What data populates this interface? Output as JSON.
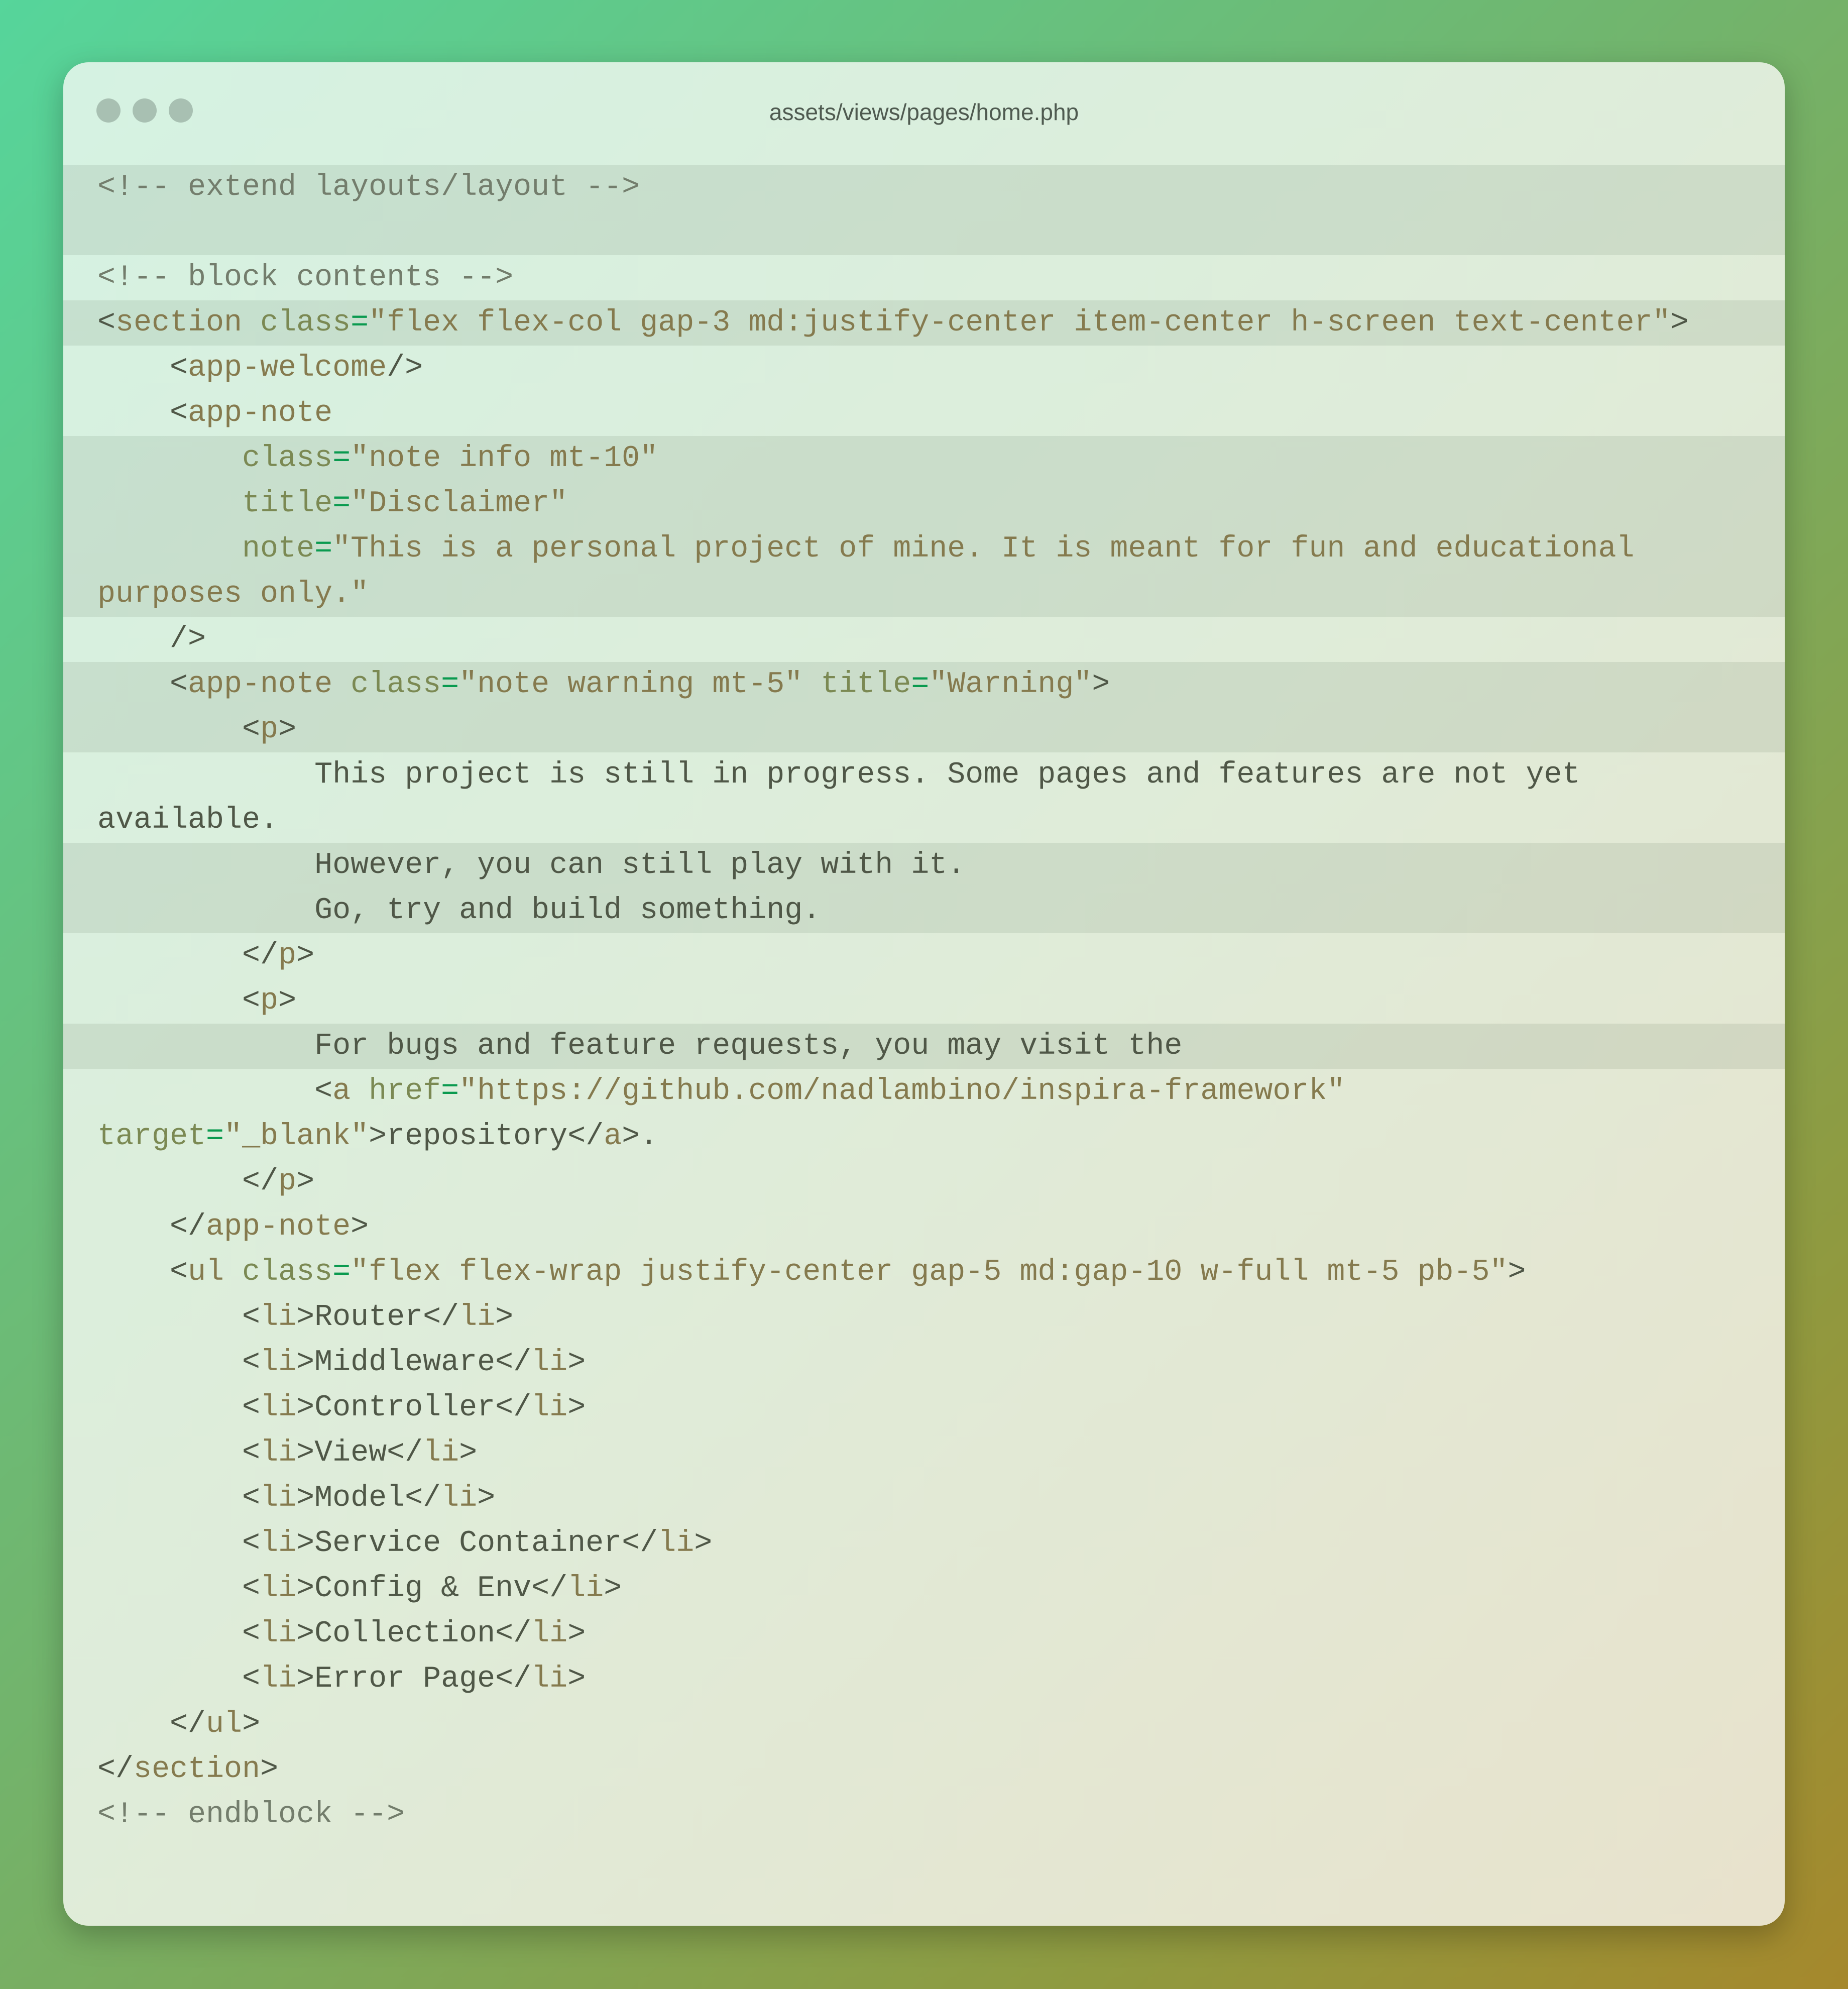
{
  "window": {
    "title": "assets/views/pages/home.php"
  },
  "code": {
    "lines": [
      {
        "hl": true,
        "tokens": [
          [
            "cm",
            "<!-- extend layouts/layout -->"
          ]
        ]
      },
      {
        "hl": true,
        "tokens": []
      },
      {
        "hl": false,
        "tokens": [
          [
            "cm",
            "<!-- block contents -->"
          ]
        ]
      },
      {
        "hl": true,
        "tokens": [
          [
            "p",
            "<"
          ],
          [
            "tag",
            "section"
          ],
          [
            "p",
            " "
          ],
          [
            "attr",
            "class"
          ],
          [
            "eq",
            "="
          ],
          [
            "str",
            "\"flex flex-col gap-3 md:justify-center item-center h-screen text-center\""
          ],
          [
            "p",
            ">"
          ]
        ]
      },
      {
        "hl": false,
        "tokens": [
          [
            "p",
            "    <"
          ],
          [
            "tag",
            "app-welcome"
          ],
          [
            "p",
            "/>"
          ]
        ]
      },
      {
        "hl": false,
        "tokens": [
          [
            "p",
            "    <"
          ],
          [
            "tag",
            "app-note"
          ]
        ]
      },
      {
        "hl": true,
        "tokens": [
          [
            "p",
            "        "
          ],
          [
            "attr",
            "class"
          ],
          [
            "eq",
            "="
          ],
          [
            "str",
            "\"note info mt-10\""
          ]
        ]
      },
      {
        "hl": true,
        "tokens": [
          [
            "p",
            "        "
          ],
          [
            "attr",
            "title"
          ],
          [
            "eq",
            "="
          ],
          [
            "str",
            "\"Disclaimer\""
          ]
        ]
      },
      {
        "hl": true,
        "tokens": [
          [
            "p",
            "        "
          ],
          [
            "attr",
            "note"
          ],
          [
            "eq",
            "="
          ],
          [
            "str",
            "\"This is a personal project of mine. It is meant for fun and educational"
          ]
        ]
      },
      {
        "hl": true,
        "tokens": [
          [
            "str",
            "purposes only.\""
          ]
        ]
      },
      {
        "hl": false,
        "tokens": [
          [
            "p",
            "    />"
          ]
        ]
      },
      {
        "hl": true,
        "tokens": [
          [
            "p",
            "    <"
          ],
          [
            "tag",
            "app-note"
          ],
          [
            "p",
            " "
          ],
          [
            "attr",
            "class"
          ],
          [
            "eq",
            "="
          ],
          [
            "str",
            "\"note warning mt-5\""
          ],
          [
            "p",
            " "
          ],
          [
            "attr",
            "title"
          ],
          [
            "eq",
            "="
          ],
          [
            "str",
            "\"Warning\""
          ],
          [
            "p",
            ">"
          ]
        ]
      },
      {
        "hl": true,
        "tokens": [
          [
            "p",
            "        <"
          ],
          [
            "tag",
            "p"
          ],
          [
            "p",
            ">"
          ]
        ]
      },
      {
        "hl": false,
        "tokens": [
          [
            "txt",
            "            This project is still in progress. Some pages and features are not yet"
          ]
        ]
      },
      {
        "hl": false,
        "tokens": [
          [
            "txt",
            "available."
          ]
        ]
      },
      {
        "hl": true,
        "tokens": [
          [
            "txt",
            "            However, you can still play with it."
          ]
        ]
      },
      {
        "hl": true,
        "tokens": [
          [
            "txt",
            "            Go, try and build something."
          ]
        ]
      },
      {
        "hl": false,
        "tokens": [
          [
            "p",
            "        </"
          ],
          [
            "tag",
            "p"
          ],
          [
            "p",
            ">"
          ]
        ]
      },
      {
        "hl": false,
        "tokens": [
          [
            "p",
            "        <"
          ],
          [
            "tag",
            "p"
          ],
          [
            "p",
            ">"
          ]
        ]
      },
      {
        "hl": true,
        "tokens": [
          [
            "txt",
            "            For bugs and feature requests, you may visit the"
          ]
        ]
      },
      {
        "hl": false,
        "tokens": [
          [
            "p",
            "            <"
          ],
          [
            "tag",
            "a"
          ],
          [
            "p",
            " "
          ],
          [
            "attr",
            "href"
          ],
          [
            "eq",
            "="
          ],
          [
            "str",
            "\"https://github.com/nadlambino/inspira-framework\""
          ]
        ]
      },
      {
        "hl": false,
        "tokens": [
          [
            "attr",
            "target"
          ],
          [
            "eq",
            "="
          ],
          [
            "str",
            "\"_blank\""
          ],
          [
            "p",
            ">"
          ],
          [
            "txt",
            "repository"
          ],
          [
            "p",
            "</"
          ],
          [
            "tag",
            "a"
          ],
          [
            "p",
            ">."
          ]
        ]
      },
      {
        "hl": false,
        "tokens": [
          [
            "p",
            "        </"
          ],
          [
            "tag",
            "p"
          ],
          [
            "p",
            ">"
          ]
        ]
      },
      {
        "hl": false,
        "tokens": [
          [
            "p",
            "    </"
          ],
          [
            "tag",
            "app-note"
          ],
          [
            "p",
            ">"
          ]
        ]
      },
      {
        "hl": false,
        "tokens": [
          [
            "p",
            "    <"
          ],
          [
            "tag",
            "ul"
          ],
          [
            "p",
            " "
          ],
          [
            "attr",
            "class"
          ],
          [
            "eq",
            "="
          ],
          [
            "str",
            "\"flex flex-wrap justify-center gap-5 md:gap-10 w-full mt-5 pb-5\""
          ],
          [
            "p",
            ">"
          ]
        ]
      },
      {
        "hl": false,
        "tokens": [
          [
            "p",
            "        <"
          ],
          [
            "tag",
            "li"
          ],
          [
            "p",
            ">"
          ],
          [
            "txt",
            "Router"
          ],
          [
            "p",
            "</"
          ],
          [
            "tag",
            "li"
          ],
          [
            "p",
            ">"
          ]
        ]
      },
      {
        "hl": false,
        "tokens": [
          [
            "p",
            "        <"
          ],
          [
            "tag",
            "li"
          ],
          [
            "p",
            ">"
          ],
          [
            "txt",
            "Middleware"
          ],
          [
            "p",
            "</"
          ],
          [
            "tag",
            "li"
          ],
          [
            "p",
            ">"
          ]
        ]
      },
      {
        "hl": false,
        "tokens": [
          [
            "p",
            "        <"
          ],
          [
            "tag",
            "li"
          ],
          [
            "p",
            ">"
          ],
          [
            "txt",
            "Controller"
          ],
          [
            "p",
            "</"
          ],
          [
            "tag",
            "li"
          ],
          [
            "p",
            ">"
          ]
        ]
      },
      {
        "hl": false,
        "tokens": [
          [
            "p",
            "        <"
          ],
          [
            "tag",
            "li"
          ],
          [
            "p",
            ">"
          ],
          [
            "txt",
            "View"
          ],
          [
            "p",
            "</"
          ],
          [
            "tag",
            "li"
          ],
          [
            "p",
            ">"
          ]
        ]
      },
      {
        "hl": false,
        "tokens": [
          [
            "p",
            "        <"
          ],
          [
            "tag",
            "li"
          ],
          [
            "p",
            ">"
          ],
          [
            "txt",
            "Model"
          ],
          [
            "p",
            "</"
          ],
          [
            "tag",
            "li"
          ],
          [
            "p",
            ">"
          ]
        ]
      },
      {
        "hl": false,
        "tokens": [
          [
            "p",
            "        <"
          ],
          [
            "tag",
            "li"
          ],
          [
            "p",
            ">"
          ],
          [
            "txt",
            "Service Container"
          ],
          [
            "p",
            "</"
          ],
          [
            "tag",
            "li"
          ],
          [
            "p",
            ">"
          ]
        ]
      },
      {
        "hl": false,
        "tokens": [
          [
            "p",
            "        <"
          ],
          [
            "tag",
            "li"
          ],
          [
            "p",
            ">"
          ],
          [
            "txt",
            "Config & Env"
          ],
          [
            "p",
            "</"
          ],
          [
            "tag",
            "li"
          ],
          [
            "p",
            ">"
          ]
        ]
      },
      {
        "hl": false,
        "tokens": [
          [
            "p",
            "        <"
          ],
          [
            "tag",
            "li"
          ],
          [
            "p",
            ">"
          ],
          [
            "txt",
            "Collection"
          ],
          [
            "p",
            "</"
          ],
          [
            "tag",
            "li"
          ],
          [
            "p",
            ">"
          ]
        ]
      },
      {
        "hl": false,
        "tokens": [
          [
            "p",
            "        <"
          ],
          [
            "tag",
            "li"
          ],
          [
            "p",
            ">"
          ],
          [
            "txt",
            "Error Page"
          ],
          [
            "p",
            "</"
          ],
          [
            "tag",
            "li"
          ],
          [
            "p",
            ">"
          ]
        ]
      },
      {
        "hl": false,
        "tokens": [
          [
            "p",
            "    </"
          ],
          [
            "tag",
            "ul"
          ],
          [
            "p",
            ">"
          ]
        ]
      },
      {
        "hl": false,
        "tokens": [
          [
            "p",
            "</"
          ],
          [
            "tag",
            "section"
          ],
          [
            "p",
            ">"
          ]
        ]
      },
      {
        "hl": false,
        "tokens": [
          [
            "cm",
            "<!-- endblock -->"
          ]
        ]
      }
    ]
  }
}
